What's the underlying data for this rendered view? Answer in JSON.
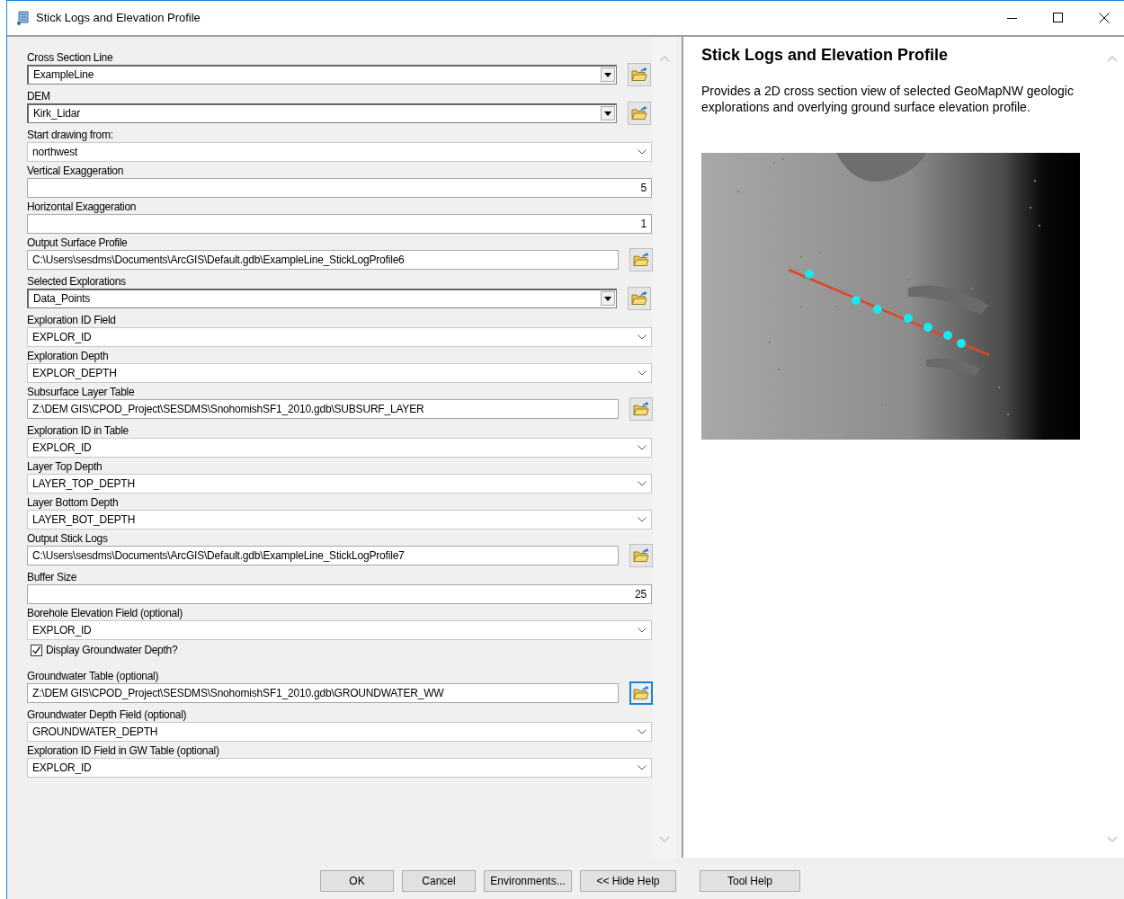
{
  "window": {
    "title": "Stick Logs and Elevation Profile"
  },
  "parameters": [
    {
      "kind": "combo",
      "label": "Cross Section Line",
      "value": "ExampleLine",
      "browse_focused": false
    },
    {
      "kind": "combo",
      "label": "DEM",
      "value": "Kirk_Lidar",
      "browse_focused": false
    },
    {
      "kind": "select",
      "label": "Start drawing from:",
      "value": "northwest"
    },
    {
      "kind": "number",
      "label": "Vertical Exaggeration",
      "value": "5"
    },
    {
      "kind": "number",
      "label": "Horizontal Exaggeration",
      "value": "1"
    },
    {
      "kind": "path",
      "label": "Output Surface Profile",
      "value": "C:\\Users\\sesdms\\Documents\\ArcGIS\\Default.gdb\\ExampleLine_StickLogProfile6",
      "browse_focused": false
    },
    {
      "kind": "combo",
      "label": "Selected Explorations",
      "value": "Data_Points",
      "browse_focused": false
    },
    {
      "kind": "select",
      "label": "Exploration ID Field",
      "value": "EXPLOR_ID"
    },
    {
      "kind": "select",
      "label": "Exploration Depth",
      "value": "EXPLOR_DEPTH"
    },
    {
      "kind": "path",
      "label": "Subsurface Layer Table",
      "value": "Z:\\DEM GIS\\CPOD_Project\\SESDMS\\SnohomishSF1_2010.gdb\\SUBSURF_LAYER",
      "browse_focused": false
    },
    {
      "kind": "select",
      "label": "Exploration ID in Table",
      "value": "EXPLOR_ID"
    },
    {
      "kind": "select",
      "label": "Layer Top Depth",
      "value": "LAYER_TOP_DEPTH"
    },
    {
      "kind": "select",
      "label": "Layer Bottom Depth",
      "value": "LAYER_BOT_DEPTH"
    },
    {
      "kind": "path",
      "label": "Output Stick Logs",
      "value": "C:\\Users\\sesdms\\Documents\\ArcGIS\\Default.gdb\\ExampleLine_StickLogProfile7",
      "browse_focused": false
    },
    {
      "kind": "number",
      "label": "Buffer Size",
      "value": "25"
    },
    {
      "kind": "select",
      "label": "Borehole Elevation Field (optional)",
      "value": "EXPLOR_ID"
    },
    {
      "kind": "checkbox",
      "label": "Display Groundwater Depth?",
      "checked": true
    },
    {
      "kind": "path",
      "label": "Groundwater Table (optional)",
      "value": "Z:\\DEM GIS\\CPOD_Project\\SESDMS\\SnohomishSF1_2010.gdb\\GROUNDWATER_WW",
      "browse_focused": true
    },
    {
      "kind": "select",
      "label": "Groundwater Depth Field (optional)",
      "value": "GROUNDWATER_DEPTH"
    },
    {
      "kind": "select",
      "label": "Exploration ID Field in GW Table (optional)",
      "value": "EXPLOR_ID"
    }
  ],
  "help": {
    "title": "Stick Logs and Elevation Profile",
    "description": "Provides a 2D cross section view of selected GeoMapNW geologic explorations and overlying ground surface elevation profile."
  },
  "buttons": [
    {
      "label": "OK"
    },
    {
      "label": "Cancel"
    },
    {
      "label": "Environments..."
    },
    {
      "label": "<< Hide Help"
    },
    {
      "label": "Tool Help"
    }
  ]
}
